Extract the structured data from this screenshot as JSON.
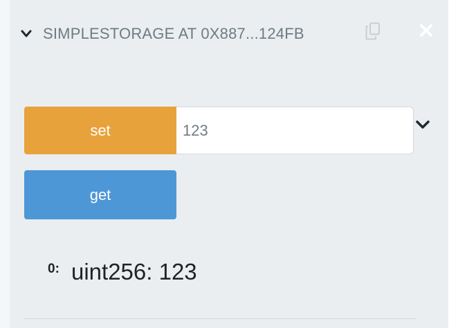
{
  "contract": {
    "title": "SIMPLESTORAGE AT 0X887...124FB",
    "collapse_icon": "chevron-down-icon",
    "copy_icon": "copy-icon",
    "close_icon": "close-icon"
  },
  "functions": {
    "set": {
      "label": "set",
      "value": "123",
      "color": "#e8a23b",
      "expand_icon": "chevron-down-icon"
    },
    "get": {
      "label": "get",
      "color": "#4e97d7"
    }
  },
  "output": {
    "index": "0:",
    "value": "uint256: 123"
  }
}
